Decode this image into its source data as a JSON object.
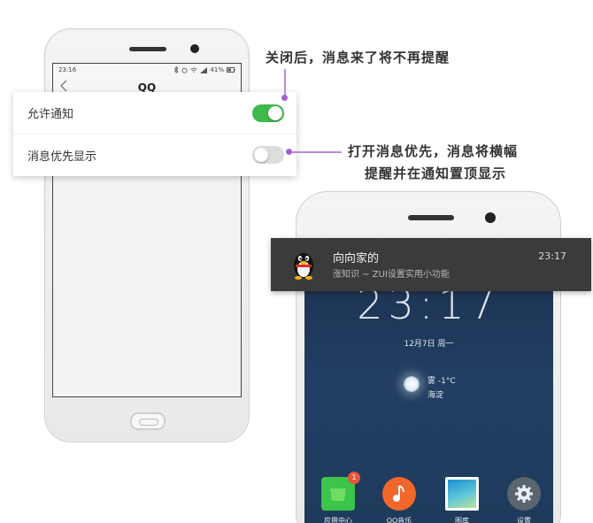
{
  "left_phone": {
    "status_time": "23:16",
    "battery": "41%",
    "app_title": "QQ",
    "back_icon": "chevron-left-icon"
  },
  "settings": {
    "items": [
      {
        "label": "允许通知",
        "state": "on"
      },
      {
        "label": "消息优先显示",
        "state": "off"
      }
    ]
  },
  "annotations": {
    "top": "关闭后，消息来了将不再提醒",
    "middle_line1": "打开消息优先，消息将横幅",
    "middle_line2": "提醒并在通知置顶显示"
  },
  "notification": {
    "title": "向向家的",
    "body": "涨知识 ~ ZUI设置实用小功能",
    "time": "23:17",
    "avatar_icon": "qq-penguin-icon"
  },
  "lockscreen": {
    "time": "23:17",
    "date": "12月7日  周一",
    "weather_temp": "雾 -1°C",
    "weather_location": "海淀"
  },
  "dock": {
    "items": [
      {
        "label": "应用中心",
        "icon": "app-center-icon",
        "badge": "1"
      },
      {
        "label": "QQ音乐",
        "icon": "qq-music-icon"
      },
      {
        "label": "图库",
        "icon": "gallery-icon"
      },
      {
        "label": "设置",
        "icon": "settings-gear-icon"
      }
    ]
  },
  "colors": {
    "toggle_on": "#3fb94a",
    "toggle_off": "#dddddd",
    "annotation_dot": "#a461d8",
    "notification_bg": "#3b3b3b",
    "app_center": "#3cc44b",
    "qq_music": "#f2662a",
    "gallery": "#2fa3d8",
    "settings": "#5b6570",
    "badge": "#e8553d"
  }
}
